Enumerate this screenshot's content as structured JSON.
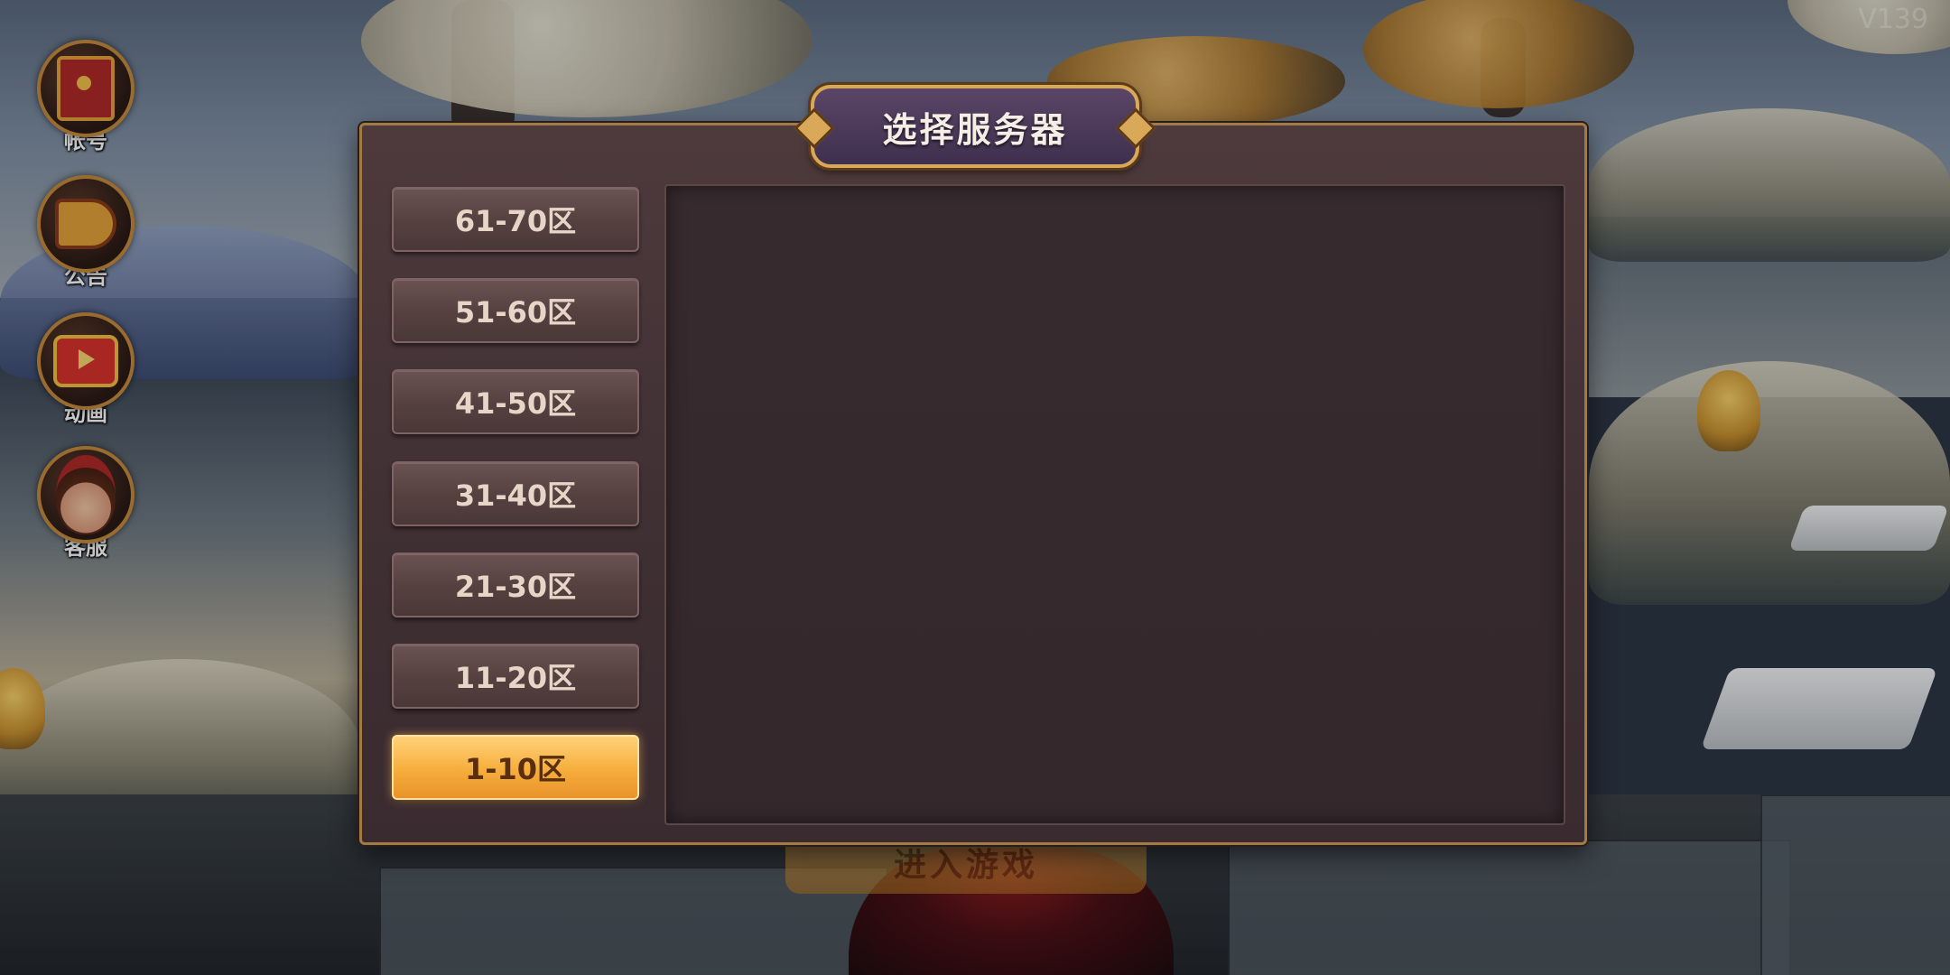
{
  "side_menu": {
    "account_label": "帐号",
    "notice_label": "公告",
    "animation_label": "动画",
    "service_label": "客服"
  },
  "dialog": {
    "title": "选择服务器",
    "zones": [
      "61-70区",
      "51-60区",
      "41-50区",
      "31-40区",
      "21-30区",
      "11-20区",
      "1-10区"
    ],
    "active_zone": "1-10区"
  },
  "background": {
    "enter_game_label": "进入游戏",
    "watermark": "V139"
  },
  "colors": {
    "active_zone_bg": "#f6ad3c",
    "zone_bg": "#54403f",
    "dialog_border": "#a27a45",
    "title_plate_bg": "#4a3859"
  }
}
